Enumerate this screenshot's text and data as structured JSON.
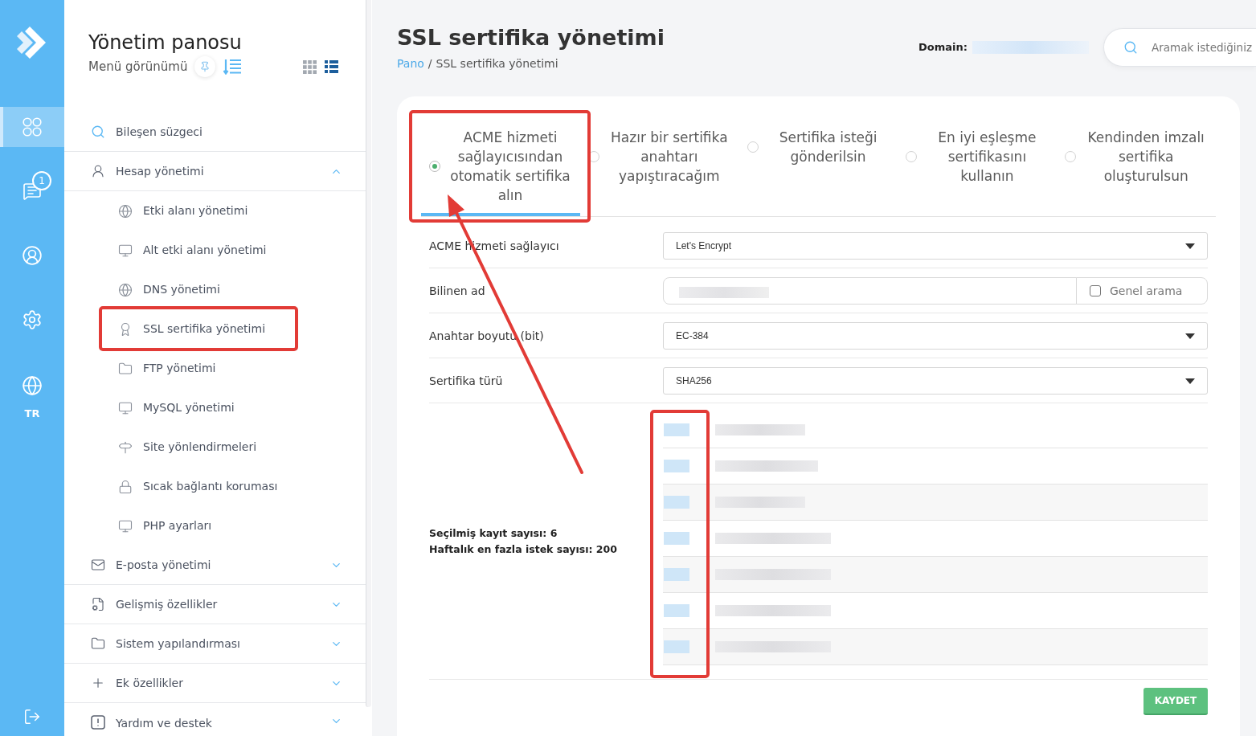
{
  "rail": {
    "items": [
      {
        "selected": true
      },
      {
        "selected": false,
        "badge": "1"
      },
      {
        "selected": false
      },
      {
        "selected": false
      },
      {
        "selected": false,
        "label": "TR"
      }
    ]
  },
  "sidebar": {
    "title": "Yönetim panosu",
    "view_label": "Menü görünümü",
    "view_modes": [
      {
        "selected": false
      },
      {
        "selected": true
      }
    ],
    "filter": {
      "label": "Bileşen süzgeci"
    },
    "menu": [
      {
        "label": "Hesap yönetimi",
        "expanded": true,
        "children": [
          {
            "label": "Etki alanı yönetimi"
          },
          {
            "label": "Alt etki alanı yönetimi"
          },
          {
            "label": "DNS yönetimi"
          },
          {
            "label": "SSL sertifika yönetimi"
          },
          {
            "label": "FTP yönetimi"
          },
          {
            "label": "MySQL yönetimi"
          },
          {
            "label": "Site yönlendirmeleri"
          },
          {
            "label": "Sıcak bağlantı koruması"
          },
          {
            "label": "PHP ayarları"
          }
        ]
      },
      {
        "label": "E-posta yönetimi",
        "expanded": false
      },
      {
        "label": "Gelişmiş özellikler",
        "expanded": false
      },
      {
        "label": "Sistem yapılandırması",
        "expanded": false
      },
      {
        "label": "Ek özellikler",
        "expanded": false
      },
      {
        "label": "Yardım ve destek",
        "expanded": false
      }
    ]
  },
  "header": {
    "title": "SSL sertifika yönetimi",
    "breadcrumb": {
      "separator": "/",
      "items": [
        {
          "label": "Pano",
          "kind": "link"
        },
        {
          "label": "SSL sertifika yönetimi",
          "kind": "current"
        }
      ]
    },
    "domain": {
      "label": "Domain:",
      "redacted": true
    },
    "search": {
      "placeholder": "Aramak istediğiniz"
    }
  },
  "tabs": [
    {
      "label": "ACME hizmeti sağlayıcısından otomatik sertifika alın",
      "selected": true
    },
    {
      "label": "Hazır bir sertifika anahtarı yapıştıracağım",
      "selected": false
    },
    {
      "label": "Sertifika isteği gönderilsin",
      "selected": false
    },
    {
      "label": "En iyi eşleşme sertifikasını kullanın",
      "selected": false
    },
    {
      "label": "Kendinden imzalı sertifika oluşturulsun",
      "selected": false
    }
  ],
  "form": {
    "rows": [
      {
        "kind": "select",
        "label": "ACME hizmeti sağlayıcı",
        "value": "Let's Encrypt"
      },
      {
        "kind": "text",
        "label": "Bilinen ad",
        "redacted": true,
        "addon": {
          "label": "Genel arama",
          "checked": false
        }
      },
      {
        "kind": "select",
        "label": "Anahtar boyutu (bit)",
        "value": "EC-384"
      },
      {
        "kind": "select",
        "label": "Sertifika türü",
        "value": "SHA256"
      }
    ],
    "summary": [
      "Seçilmiş kayıt sayısı: 6",
      "Haftalık en fazla istek sayısı: 200"
    ],
    "records": [
      {
        "redacted": true
      },
      {
        "redacted": true
      },
      {
        "redacted": true
      },
      {
        "redacted": true
      },
      {
        "redacted": true
      },
      {
        "redacted": true
      },
      {
        "redacted": true
      }
    ],
    "save_button": {
      "label": "KAYDET"
    }
  },
  "annotations": [
    {
      "kind": "frame"
    },
    {
      "kind": "frame"
    },
    {
      "kind": "arrow"
    },
    {
      "kind": "frame"
    }
  ]
}
